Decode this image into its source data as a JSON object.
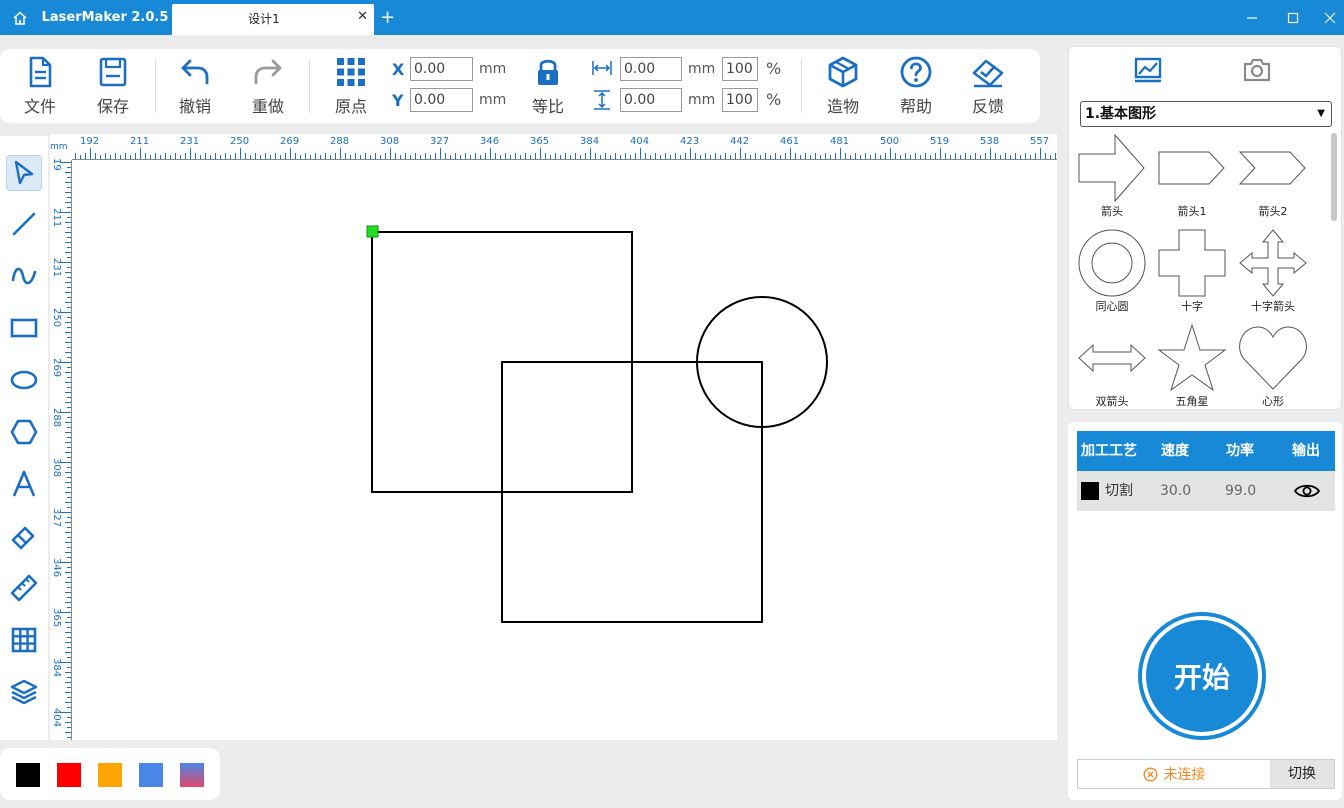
{
  "app": {
    "title": "LaserMaker 2.0.5"
  },
  "tabs": [
    {
      "label": "设计1"
    }
  ],
  "toolbar": {
    "file_label": "文件",
    "save_label": "保存",
    "undo_label": "撤销",
    "redo_label": "重做",
    "origin_label": "原点",
    "x_label": "X",
    "y_label": "Y",
    "x_value": "0.00",
    "y_value": "0.00",
    "unit": "mm",
    "lock_label": "等比",
    "width_value": "0.00",
    "height_value": "0.00",
    "width_percent": "100",
    "height_percent": "100",
    "percent_unit": "%",
    "build_label": "造物",
    "help_label": "帮助",
    "feedback_label": "反馈"
  },
  "ruler": {
    "unit": "mm",
    "horizontal_ticks": [
      "192",
      "211",
      "231",
      "250",
      "269",
      "288",
      "308",
      "327",
      "346",
      "365",
      "384",
      "404",
      "423",
      "442",
      "461",
      "481",
      "500",
      "519",
      "538",
      "557"
    ],
    "vertical_ticks": [
      "19",
      "211",
      "231",
      "250",
      "269",
      "288",
      "308",
      "327",
      "346",
      "365",
      "384",
      "404"
    ]
  },
  "left_tools": [
    {
      "name": "select-tool",
      "icon": "cursor-arrow-icon",
      "selected": true
    },
    {
      "name": "line-tool",
      "icon": "line-icon"
    },
    {
      "name": "curve-tool",
      "icon": "wave-curve-icon"
    },
    {
      "name": "rectangle-tool",
      "icon": "rectangle-icon"
    },
    {
      "name": "ellipse-tool",
      "icon": "ellipse-icon"
    },
    {
      "name": "polygon-tool",
      "icon": "hexagon-icon"
    },
    {
      "name": "text-tool",
      "icon": "letter-a-icon"
    },
    {
      "name": "eraser-tool",
      "icon": "eraser-icon"
    },
    {
      "name": "measure-tool",
      "icon": "ruler-icon"
    },
    {
      "name": "array-tool",
      "icon": "grid-icon"
    },
    {
      "name": "layer-tool",
      "icon": "layers-icon"
    }
  ],
  "palette": [
    "#000000",
    "#ff0000",
    "#ffa500",
    "#4a86e8",
    "gradient"
  ],
  "shape_library": {
    "category": "1.基本图形",
    "shapes": [
      {
        "label": "箭头",
        "icon": "arrow-shape"
      },
      {
        "label": "箭头1",
        "icon": "pentagon-arrow-shape"
      },
      {
        "label": "箭头2",
        "icon": "chevron-shape"
      },
      {
        "label": "同心圆",
        "icon": "concentric-circle-shape"
      },
      {
        "label": "十字",
        "icon": "cross-shape"
      },
      {
        "label": "十字箭头",
        "icon": "cross-arrow-shape"
      },
      {
        "label": "双箭头",
        "icon": "double-arrow-shape"
      },
      {
        "label": "五角星",
        "icon": "star-shape"
      },
      {
        "label": "心形",
        "icon": "heart-shape"
      }
    ]
  },
  "process": {
    "headers": [
      "加工工艺",
      "速度",
      "功率",
      "输出"
    ],
    "rows": [
      {
        "color": "#000000",
        "mode": "切割",
        "speed": "30.0",
        "power": "99.0",
        "output": "eye-icon"
      }
    ]
  },
  "start_label": "开始",
  "connection": {
    "status": "未连接",
    "switch_label": "切换"
  },
  "colors": {
    "accent": "#1789d6",
    "selection_handle": "#22dd22",
    "warning": "#f08a1c"
  }
}
